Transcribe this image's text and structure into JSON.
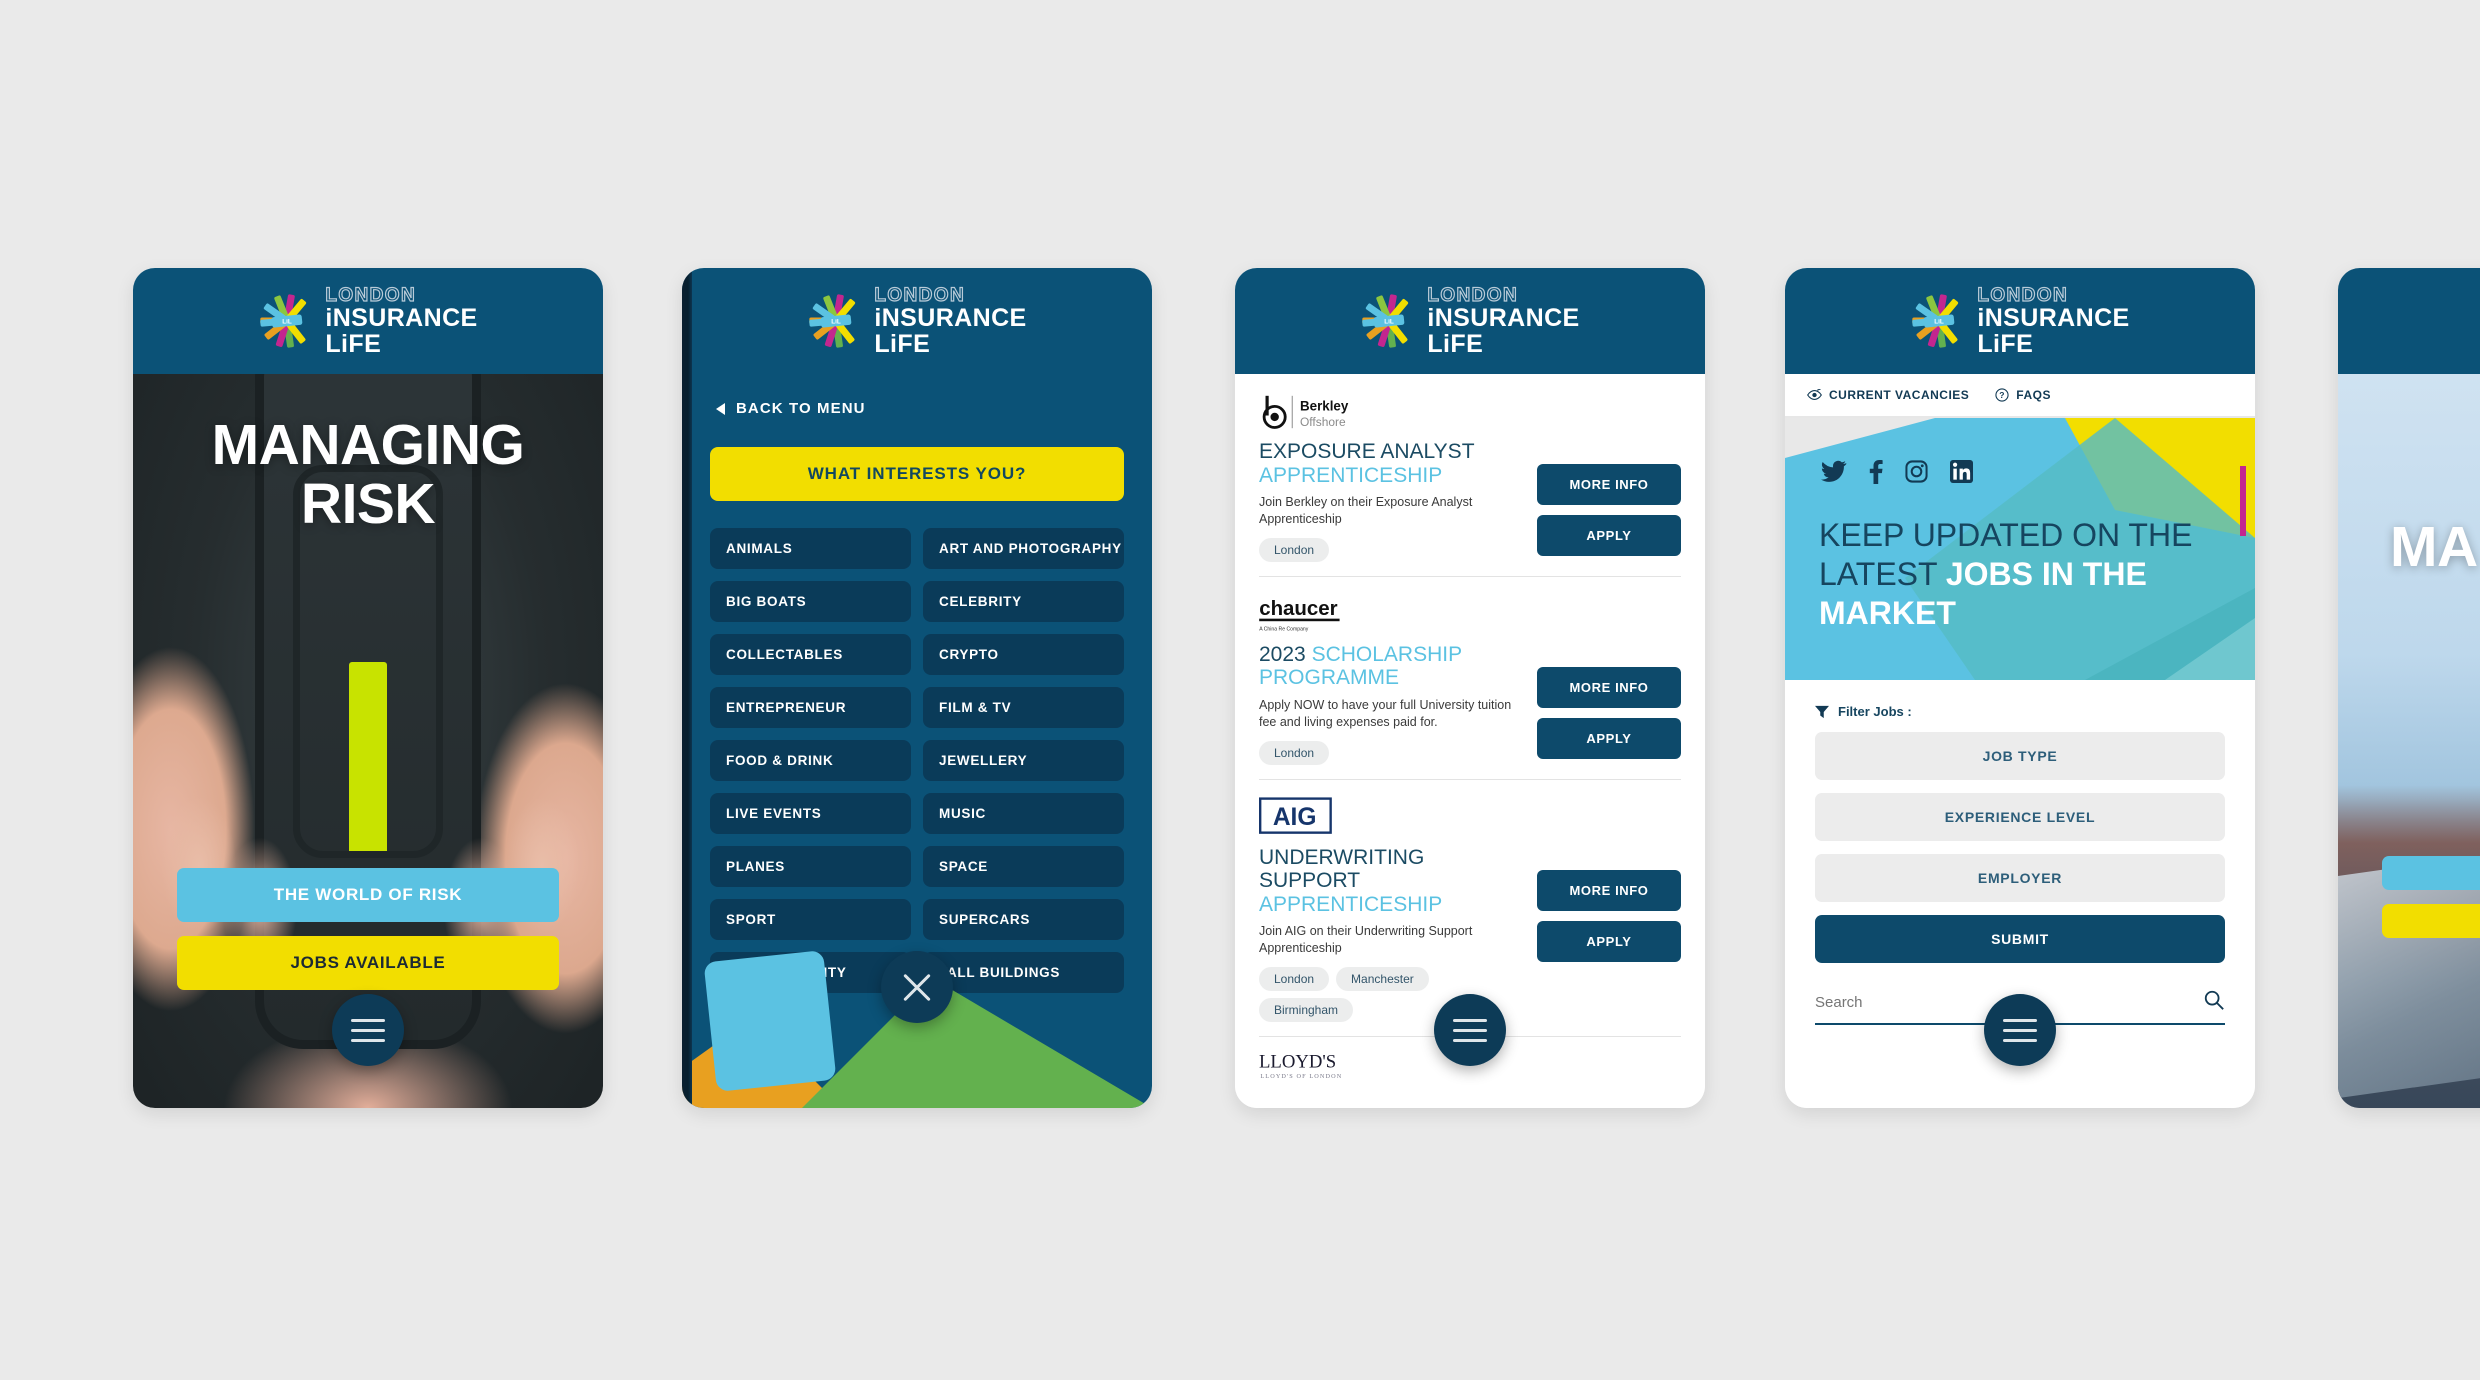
{
  "brand": {
    "logo_line1": "LONDON",
    "logo_line2": "iNSURANCE",
    "logo_line3": "LiFE",
    "logo_badge": "LiL",
    "colors": {
      "header_blue": "#0b5277",
      "deep_blue": "#0d4a6b",
      "dark_navy": "#0a3b59",
      "sky": "#5bc2e2",
      "yellow": "#f2de00",
      "page_bg": "#eaeaea",
      "green": "#63b14e",
      "magenta": "#c3268f",
      "orange": "#e8a020"
    }
  },
  "screen1": {
    "name": "home-hero",
    "title": "MANAGING RISK",
    "title_line1": "MANAGING",
    "title_line2": "RISK",
    "cta_primary": "THE WORLD OF RISK",
    "cta_secondary": "JOBS AVAILABLE",
    "fab_icon": "hamburger-menu-icon"
  },
  "screen2": {
    "name": "interests-menu",
    "back_label": "BACK TO MENU",
    "heading_button": "WHAT INTERESTS YOU?",
    "interests": [
      "ANIMALS",
      "ART AND PHOTOGRAPHY",
      "BIG BOATS",
      "CELEBRITY",
      "COLLECTABLES",
      "CRYPTO",
      "ENTREPRENEUR",
      "FILM & TV",
      "FOOD & DRINK",
      "JEWELLERY",
      "LIVE EVENTS",
      "MUSIC",
      "PLANES",
      "SPACE",
      "SPORT",
      "SUPERCARS",
      "SUSTAINABILITY",
      "TALL BUILDINGS"
    ],
    "fab_icon": "close-x-icon"
  },
  "screen3": {
    "name": "job-listings",
    "jobs": [
      {
        "employer": "Berkley Offshore",
        "logo_text_main": "Berkley",
        "logo_text_sub": "Offshore",
        "title_plain": "EXPOSURE ANALYST",
        "title_highlight": "APPRENTICESHIP",
        "description": "Join Berkley on their Exposure Analyst Apprenticeship",
        "locations": [
          "London"
        ],
        "btn_more": "MORE INFO",
        "btn_apply": "APPLY"
      },
      {
        "employer": "chaucer",
        "logo_text_main": "chaucer",
        "logo_text_sub": "A China Re Company",
        "title_plain": "2023",
        "title_highlight": "SCHOLARSHIP PROGRAMME",
        "description": "Apply NOW to have your full University tuition fee and living expenses paid for.",
        "locations": [
          "London"
        ],
        "btn_more": "MORE INFO",
        "btn_apply": "APPLY"
      },
      {
        "employer": "AIG",
        "logo_text_main": "AIG",
        "logo_text_sub": "",
        "title_plain": "UNDERWRITING SUPPORT",
        "title_highlight": "APPRENTICESHIP",
        "description": "Join AIG on their Underwriting Support Apprenticeship",
        "locations": [
          "London",
          "Manchester",
          "Birmingham"
        ],
        "btn_more": "MORE INFO",
        "btn_apply": "APPLY"
      }
    ],
    "next_logo_main": "LLOYD'S",
    "next_logo_sub": "LLOYD'S OF LONDON",
    "fab_icon": "hamburger-menu-icon"
  },
  "screen4": {
    "name": "vacancies-filter",
    "nav": [
      {
        "label": "CURRENT VACANCIES",
        "icon": "eye-search-icon"
      },
      {
        "label": "FAQS",
        "icon": "question-circle-icon"
      }
    ],
    "social": [
      {
        "name": "twitter-icon"
      },
      {
        "name": "facebook-icon"
      },
      {
        "name": "instagram-icon"
      },
      {
        "name": "linkedin-icon"
      }
    ],
    "banner_plain_1": "KEEP UPDATED ON THE LATEST ",
    "banner_bold": "JOBS IN THE MARKET",
    "filter_label": "Filter Jobs :",
    "filter_icon": "funnel-icon",
    "filters": [
      "JOB TYPE",
      "EXPERIENCE LEVEL",
      "EMPLOYER"
    ],
    "submit_label": "SUBMIT",
    "search_placeholder": "Search",
    "search_value": "",
    "search_icon": "magnifier-icon",
    "fab_icon": "hamburger-menu-icon"
  },
  "screen5": {
    "name": "second-hero-partial",
    "title_partial": "MA",
    "cta_primary": "",
    "cta_secondary": ""
  }
}
